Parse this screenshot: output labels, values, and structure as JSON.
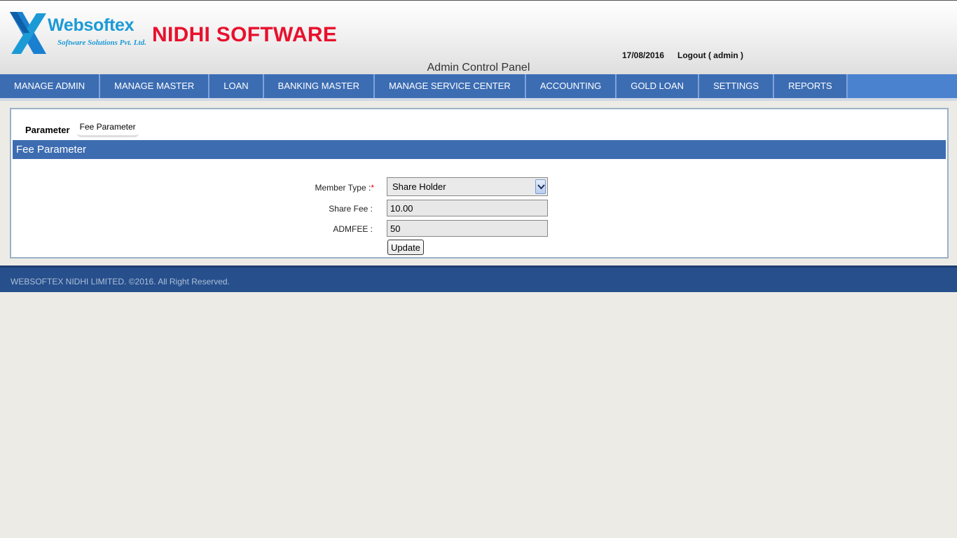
{
  "header": {
    "logo_name": "Websoftex",
    "logo_tagline": "Software Solutions Pvt. Ltd.",
    "brand_title": "NIDHI SOFTWARE",
    "date": "17/08/2016",
    "logout": "Logout ( admin )",
    "panel_title": "Admin Control Panel"
  },
  "nav": {
    "items": [
      {
        "label": "MANAGE ADMIN"
      },
      {
        "label": "MANAGE MASTER"
      },
      {
        "label": "LOAN"
      },
      {
        "label": "BANKING MASTER"
      },
      {
        "label": "MANAGE SERVICE CENTER"
      },
      {
        "label": "ACCOUNTING"
      },
      {
        "label": "GOLD LOAN"
      },
      {
        "label": "SETTINGS"
      },
      {
        "label": "REPORTS"
      }
    ]
  },
  "tabs": {
    "parent": "Parameter",
    "active": "Fee Parameter"
  },
  "section": {
    "title": "Fee Parameter"
  },
  "form": {
    "member_type_label": "Member Type :",
    "required_mark": "*",
    "member_type_value": "Share Holder",
    "share_fee_label": "Share Fee :",
    "share_fee_value": "10.00",
    "admfee_label": "ADMFEE :",
    "admfee_value": "50",
    "update_label": "Update"
  },
  "footer": {
    "text": "WEBSOFTEX NIDHI LIMITED. ©2016. All Right Reserved."
  },
  "colors": {
    "nav_bg": "#3c6db3",
    "section_bar": "#3d6cb1",
    "brand_red": "#e8112d",
    "logo_blue": "#1b9ad6",
    "footer_bg": "#264f8c"
  },
  "icons": {
    "logo": "websoftex-x-logo-icon",
    "select_arrow": "chevron-down-icon"
  }
}
